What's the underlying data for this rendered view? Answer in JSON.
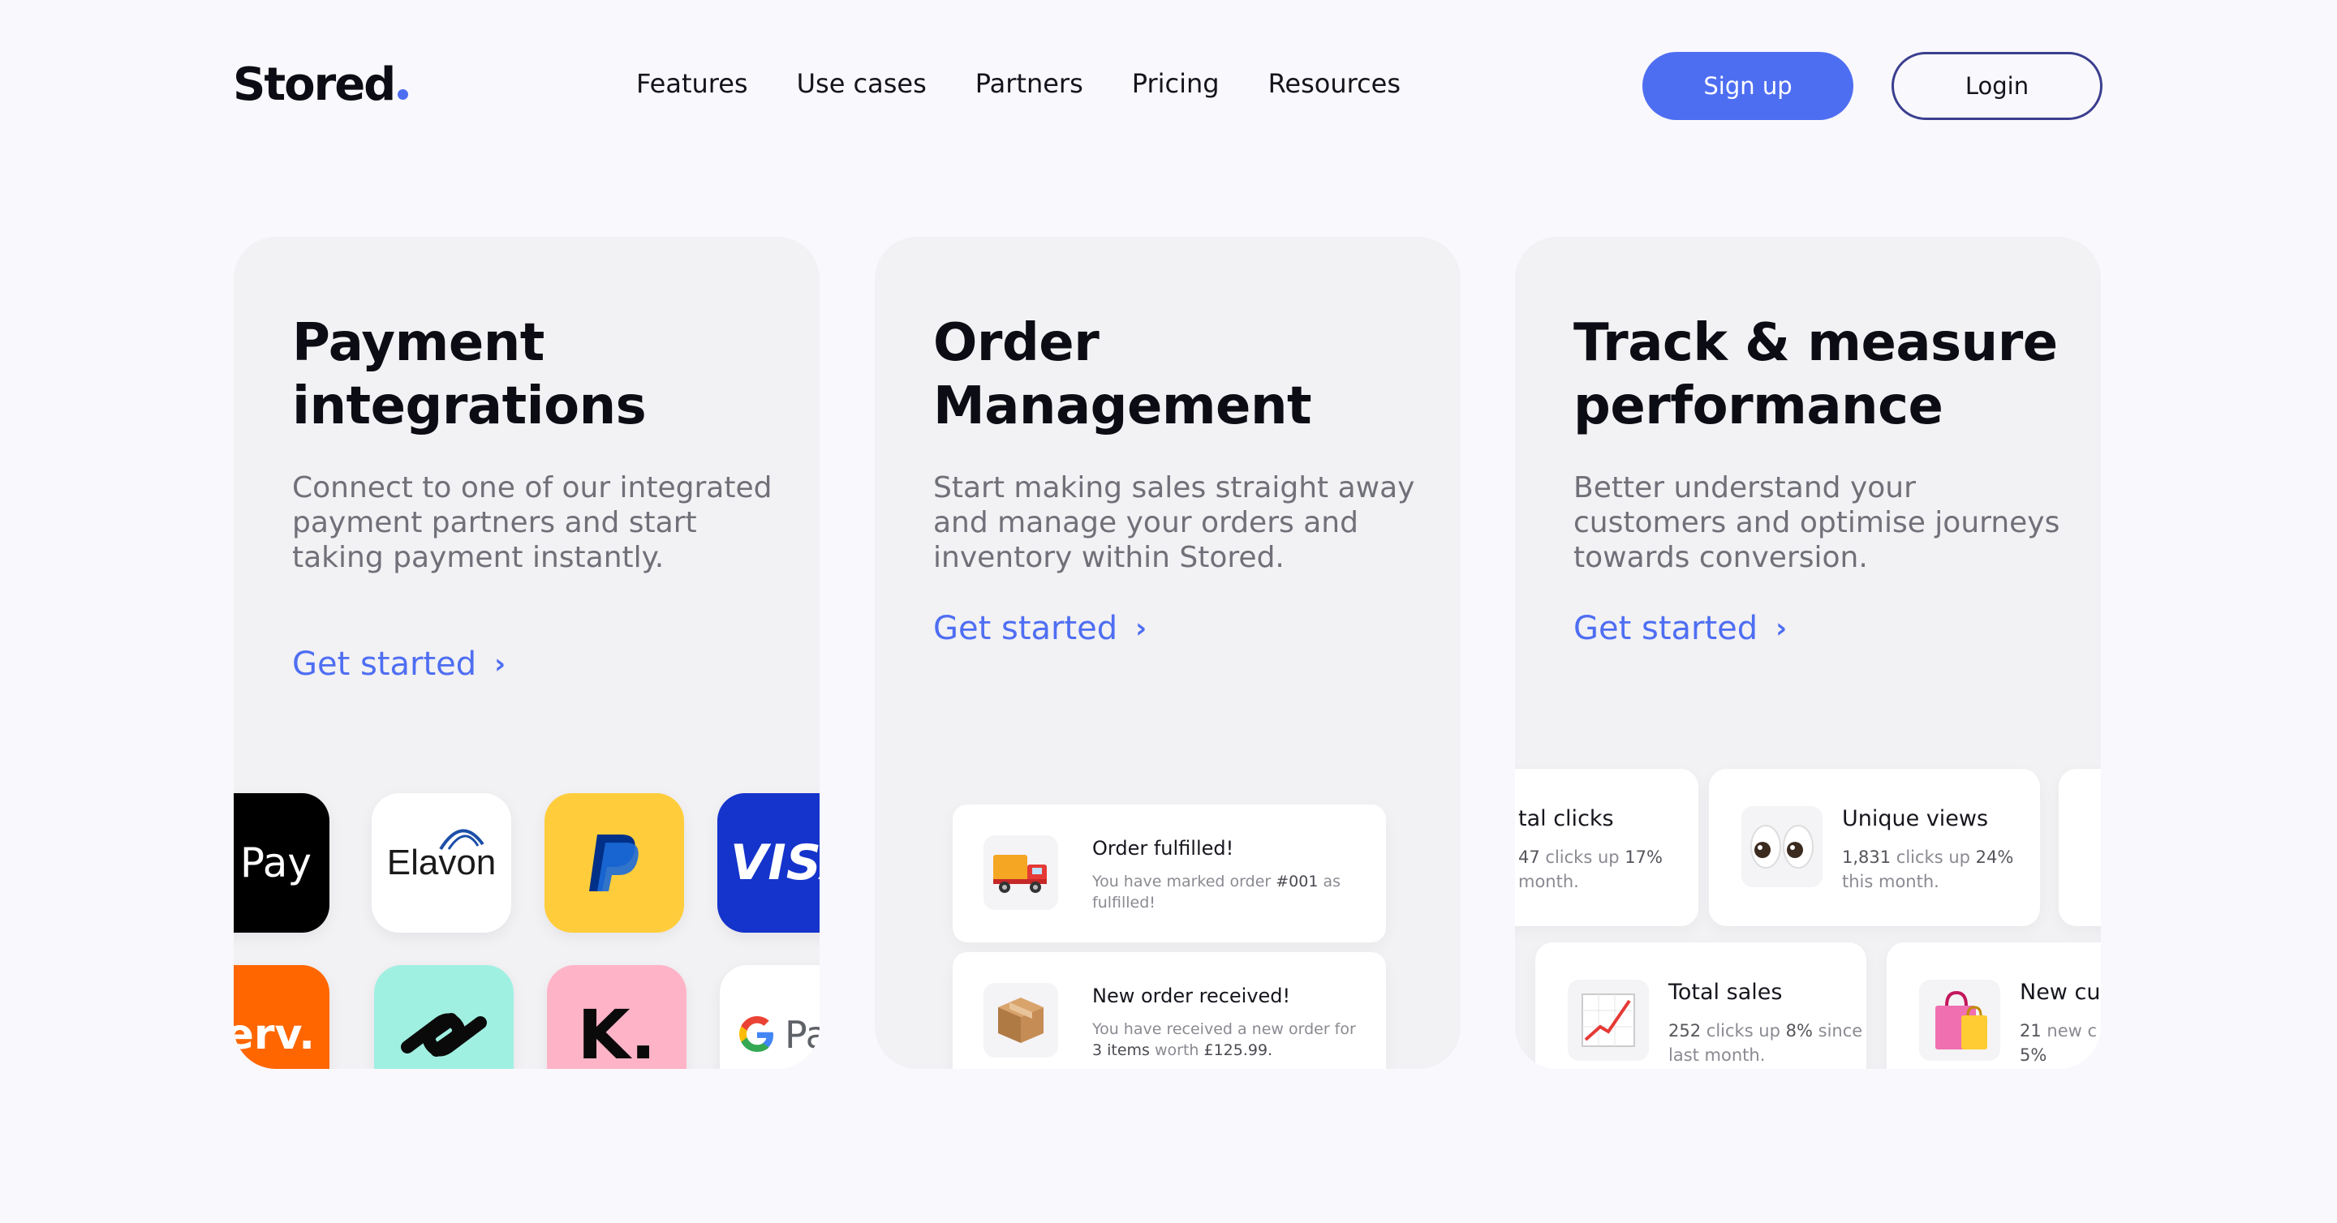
{
  "header": {
    "logo": "Stored",
    "nav": [
      "Features",
      "Use cases",
      "Partners",
      "Pricing",
      "Resources"
    ],
    "signup_label": "Sign up",
    "login_label": "Login"
  },
  "colors": {
    "accent": "#4e6ef2",
    "background": "#f9f8fc",
    "card": "#f2f1f4"
  },
  "cards": [
    {
      "title": "Payment integrations",
      "description": "Connect to one of our integrated payment partners and start taking payment instantly.",
      "cta": "Get started",
      "partners": {
        "apple_pay": "Pay",
        "elavon": "Elavon",
        "visa": "VISA",
        "fiserv": "fiserv.",
        "klarna": "K.",
        "gpay": "Pay"
      }
    },
    {
      "title": "Order Management",
      "description": "Start making sales straight away and manage your orders and inventory within Stored.",
      "cta": "Get started",
      "notifications": [
        {
          "icon": "delivery-truck-icon",
          "title": "Order fulfilled!",
          "text_a": "You have marked order ",
          "order": "#001",
          "text_b": " as fulfilled!"
        },
        {
          "icon": "package-box-icon",
          "title": "New order received!",
          "text_a": "You have received a new order for ",
          "items": "3 items",
          "text_b": " worth ",
          "amount": "£125.99."
        }
      ]
    },
    {
      "title": "Track & measure performance",
      "description": "Better understand your customers and optimise journeys towards conversion.",
      "cta": "Get started",
      "stats": [
        {
          "icon": "cursor-click-icon",
          "title": "tal clicks",
          "value": "47",
          "mid": " clicks up ",
          "pct": "17%",
          "tail": " month."
        },
        {
          "icon": "eyes-icon",
          "title": "Unique views",
          "value": "1,831",
          "mid": " clicks up ",
          "pct": "24%",
          "tail": " this month."
        },
        {
          "icon": "chart-up-icon",
          "title": "Total sales",
          "value": "252",
          "mid": " clicks up ",
          "pct": "8%",
          "tail": " since last month."
        },
        {
          "icon": "shopping-bags-icon",
          "title": "New cu",
          "value": "21",
          "mid": " new c",
          "pct": "5%",
          "tail": ""
        }
      ]
    }
  ]
}
